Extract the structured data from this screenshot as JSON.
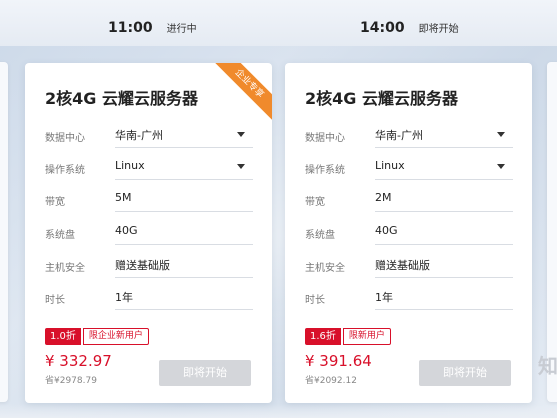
{
  "sessions": [
    {
      "time": "11:00",
      "status": "进行中"
    },
    {
      "time": "14:00",
      "status": "即将开始"
    }
  ],
  "cards": [
    {
      "title": "2核4G 云耀云服务器",
      "ribbon": "企业专享",
      "rows": [
        {
          "label": "数据中心",
          "value": "华南-广州",
          "dropdown": true
        },
        {
          "label": "操作系统",
          "value": "Linux",
          "dropdown": true
        },
        {
          "label": "带宽",
          "value": "5M",
          "dropdown": false
        },
        {
          "label": "系统盘",
          "value": "40G",
          "dropdown": false
        },
        {
          "label": "主机安全",
          "value": "赠送基础版",
          "dropdown": false
        },
        {
          "label": "时长",
          "value": "1年",
          "dropdown": false
        }
      ],
      "discount": "1.0折",
      "limit": "限企业新用户",
      "price": "¥ 332.97",
      "saved": "省¥2978.79",
      "button": "即将开始"
    },
    {
      "title": "2核4G 云耀云服务器",
      "ribbon": "",
      "rows": [
        {
          "label": "数据中心",
          "value": "华南-广州",
          "dropdown": true
        },
        {
          "label": "操作系统",
          "value": "Linux",
          "dropdown": true
        },
        {
          "label": "带宽",
          "value": "2M",
          "dropdown": false
        },
        {
          "label": "系统盘",
          "value": "40G",
          "dropdown": false
        },
        {
          "label": "主机安全",
          "value": "赠送基础版",
          "dropdown": false
        },
        {
          "label": "时长",
          "value": "1年",
          "dropdown": false
        }
      ],
      "discount": "1.6折",
      "limit": "限新用户",
      "price": "¥ 391.64",
      "saved": "省¥2092.12",
      "button": "即将开始"
    }
  ],
  "side_text": "知",
  "colors": {
    "accent": "#d8102a",
    "ribbon": "#f08a2c",
    "disabled_button": "#d4d6da"
  }
}
